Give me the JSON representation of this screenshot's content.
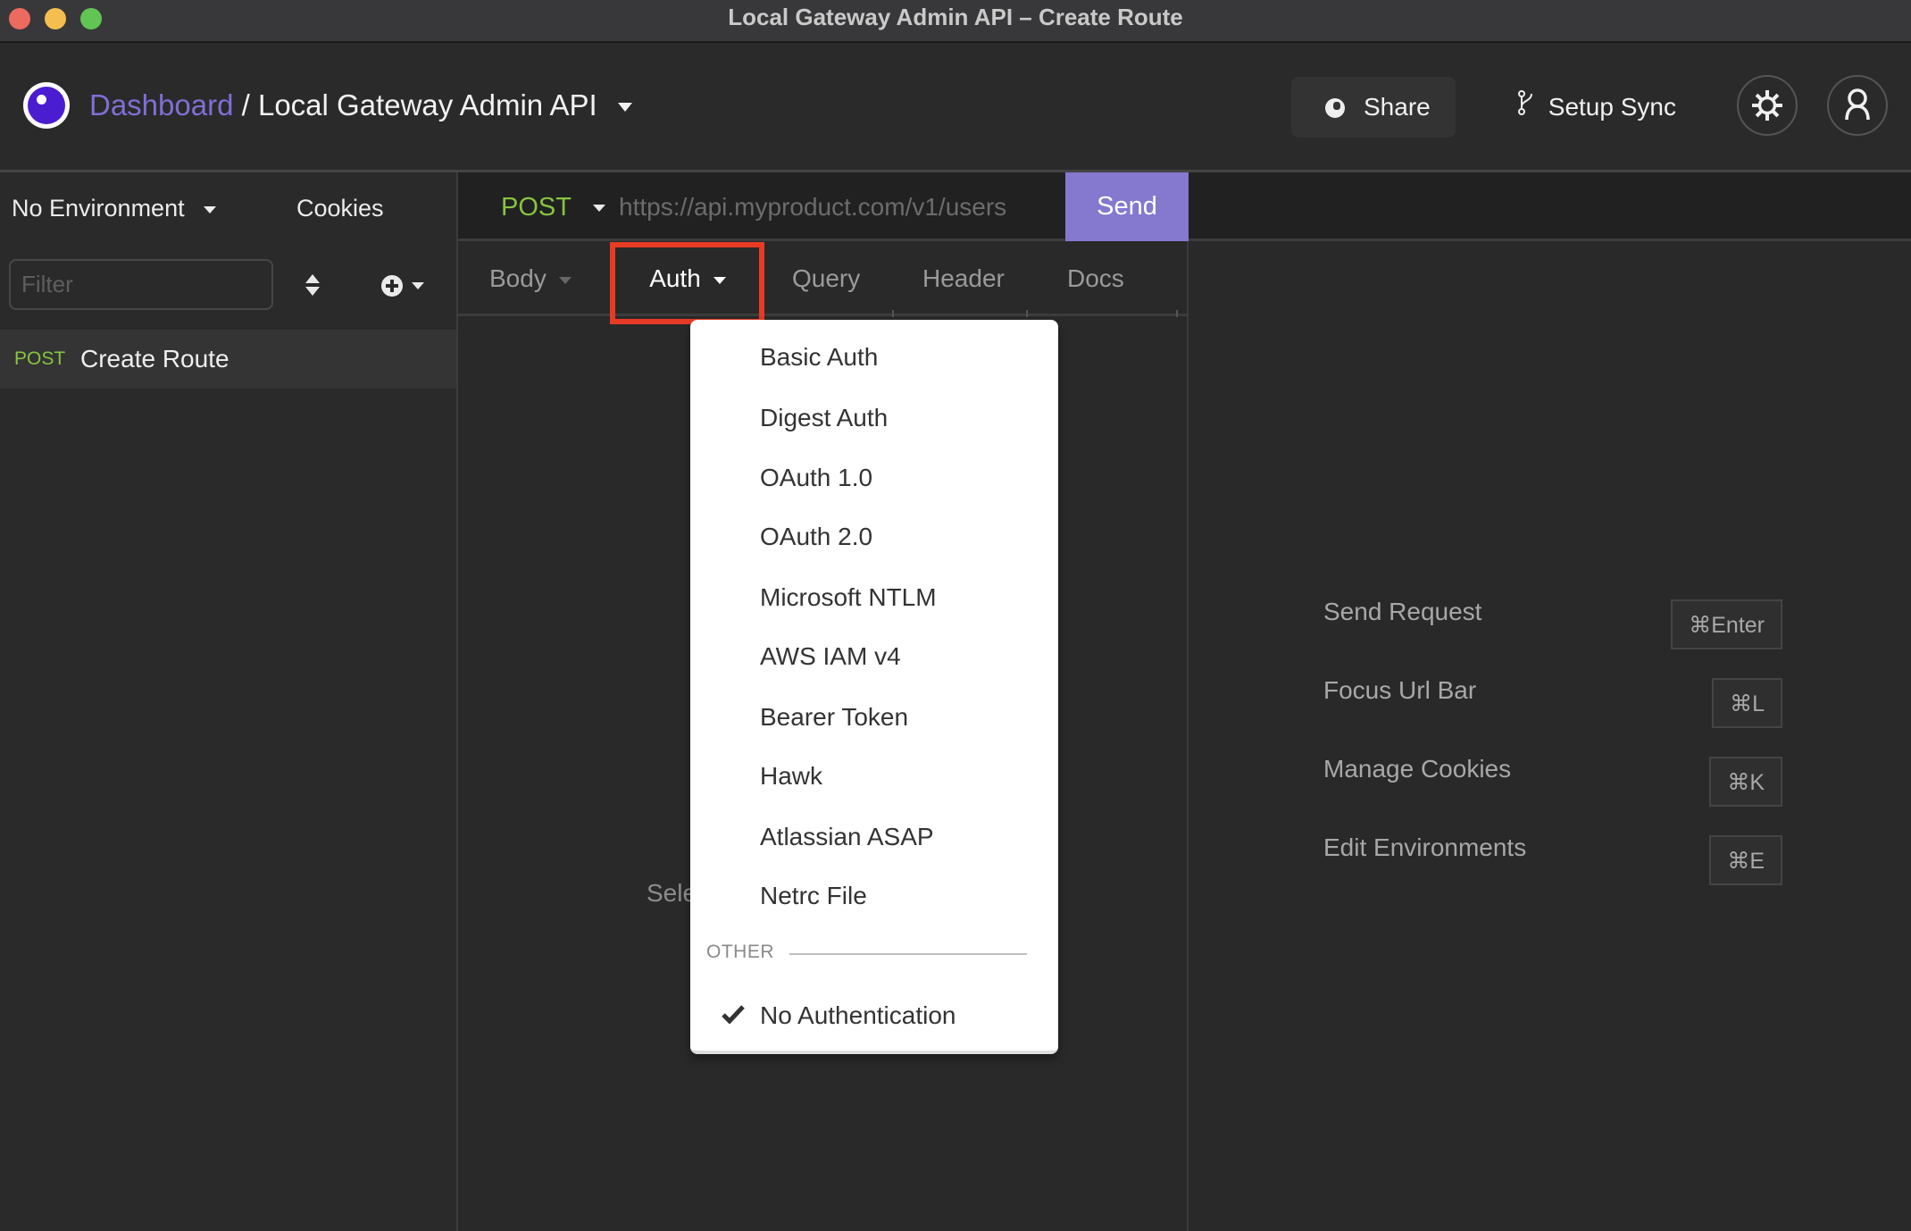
{
  "window": {
    "title": "Local Gateway Admin API – Create Route",
    "traffic_lights": {
      "close": "#ec6a5e",
      "minimize": "#f4bf4f",
      "zoom": "#61c554"
    }
  },
  "header": {
    "logo_icon": "insomnia-logo-icon",
    "breadcrumb_root": "Dashboard",
    "breadcrumb_sep": "/",
    "workspace_name": "Local Gateway Admin API",
    "share_label": "Share",
    "share_icon": "globe-icon",
    "sync_label": "Setup Sync",
    "sync_icon": "git-branch-icon",
    "settings_icon": "gear-icon",
    "account_icon": "user-icon",
    "accent_color": "#7f6fd6"
  },
  "sidebar": {
    "environment": "No Environment",
    "cookies_label": "Cookies",
    "filter_placeholder": "Filter",
    "filter_value": "",
    "requests": [
      {
        "method": "POST",
        "name": "Create Route",
        "selected": true
      }
    ]
  },
  "request": {
    "method": "POST",
    "method_color": "#87c43f",
    "url_placeholder": "https://api.myproduct.com/v1/users",
    "url_value": "",
    "send_label": "Send",
    "send_color": "#8478cf",
    "tabs": [
      {
        "label": "Body",
        "has_dropdown": true,
        "active": false
      },
      {
        "label": "Auth",
        "has_dropdown": true,
        "active": true
      },
      {
        "label": "Query",
        "has_dropdown": false,
        "active": false
      },
      {
        "label": "Header",
        "has_dropdown": false,
        "active": false
      },
      {
        "label": "Docs",
        "has_dropdown": false,
        "active": false
      }
    ],
    "body_hint_partial": "Sele"
  },
  "auth_menu": {
    "items": [
      "Basic Auth",
      "Digest Auth",
      "OAuth 1.0",
      "OAuth 2.0",
      "Microsoft NTLM",
      "AWS IAM v4",
      "Bearer Token",
      "Hawk",
      "Atlassian ASAP",
      "Netrc File"
    ],
    "other_heading": "OTHER",
    "other_items": [
      {
        "label": "No Authentication",
        "checked": true
      }
    ],
    "highlight_color": "#e83b25"
  },
  "shortcuts": [
    {
      "label": "Send Request",
      "key": "⌘Enter"
    },
    {
      "label": "Focus Url Bar",
      "key": "⌘L"
    },
    {
      "label": "Manage Cookies",
      "key": "⌘K"
    },
    {
      "label": "Edit Environments",
      "key": "⌘E"
    }
  ]
}
